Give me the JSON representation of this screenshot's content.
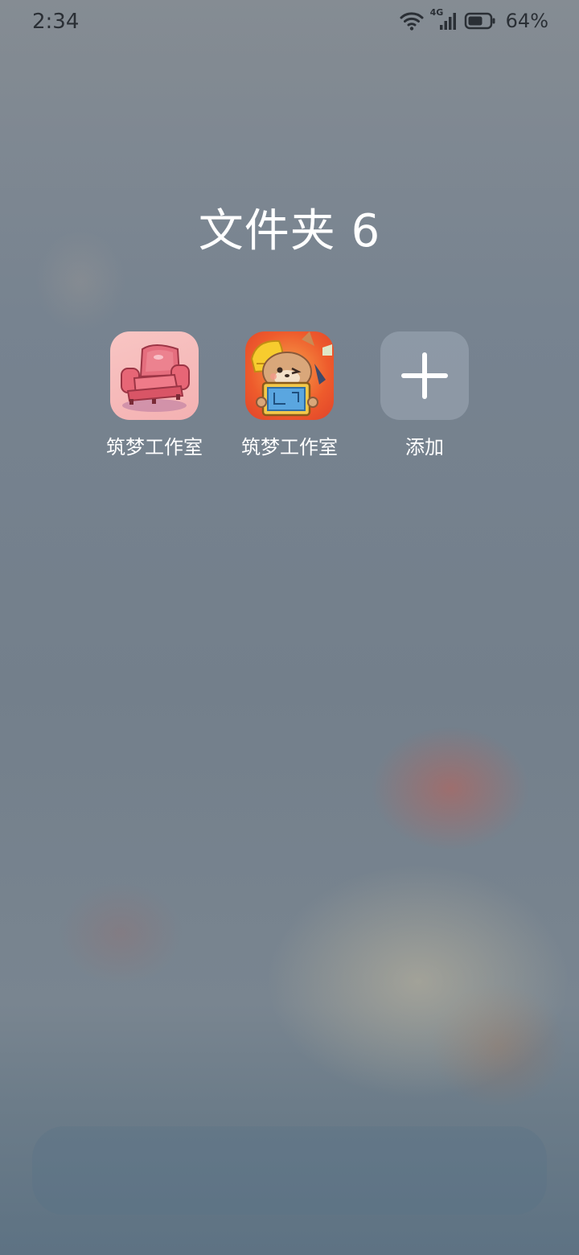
{
  "status_bar": {
    "time": "2:34",
    "network": "4G",
    "battery_percent": "64%",
    "battery_level": 0.64
  },
  "folder": {
    "title": "文件夹 6",
    "apps": [
      {
        "label": "筑梦工作室",
        "icon": "sofa-app-icon"
      },
      {
        "label": "筑梦工作室",
        "icon": "dog-builder-app-icon"
      },
      {
        "label": "添加",
        "icon": "plus-icon"
      }
    ]
  },
  "colors": {
    "text_light": "#ffffff",
    "status_text": "#2a2f35"
  }
}
